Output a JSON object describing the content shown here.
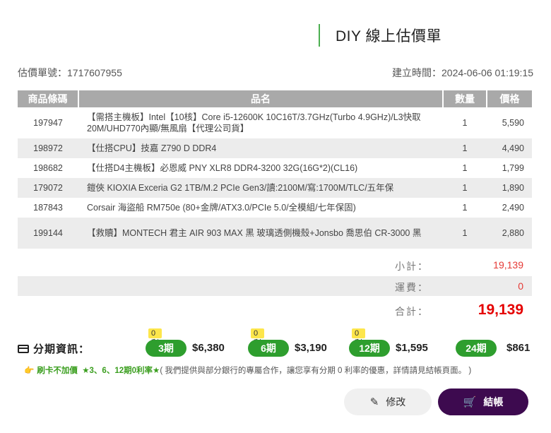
{
  "header": {
    "title": "DIY 線上估價單"
  },
  "meta": {
    "quote_no": "估價單號：1717607955",
    "created": "建立時間：2024-06-06 01:19:15"
  },
  "table": {
    "headers": [
      "商品條碼",
      "品名",
      "數量",
      "價格"
    ],
    "rows": [
      {
        "code": "197947",
        "name": "【需搭主機板】Intel【10核】Core i5-12600K 10C16T/3.7GHz(Turbo 4.9GHz)/L3快取20M/UHD770內顯/無風扇【代理公司貨】",
        "qty": "1",
        "price": "5,590"
      },
      {
        "code": "198972",
        "name": "【仕搭CPU】技嘉 Z790 D DDR4",
        "qty": "1",
        "price": "4,490"
      },
      {
        "code": "198682",
        "name": "【仕搭D4主機板】必恩威 PNY XLR8 DDR4-3200 32G(16G*2)(CL16)",
        "qty": "1",
        "price": "1,799"
      },
      {
        "code": "179072",
        "name": "鎧俠 KIOXIA Exceria G2 1TB/M.2 PCIe Gen3/讀:2100M/寫:1700M/TLC/五年保",
        "qty": "1",
        "price": "1,890"
      },
      {
        "code": "187843",
        "name": "Corsair 海盜船 RM750e (80+金牌/ATX3.0/PCIe 5.0/全模組/七年保固)",
        "qty": "1",
        "price": "2,490"
      },
      {
        "code": "199144",
        "name": "【救贖】MONTECH 君主 AIR 903 MAX 黑 玻璃透側機殼+Jonsbo 喬思伯 CR-3000 黑",
        "qty": "1",
        "price": "2,880"
      }
    ]
  },
  "summary": {
    "subtotal_label": "小計：",
    "subtotal": "19,139",
    "shipping_label": "運費：",
    "shipping": "0",
    "total_label": "合計：",
    "total": "19,139"
  },
  "installment": {
    "title": "分期資訊：",
    "plans": [
      {
        "badge": "0利率",
        "term": "3期",
        "amount": "$6,380"
      },
      {
        "badge": "0利率",
        "term": "6期",
        "amount": "$3,190"
      },
      {
        "badge": "0利率",
        "term": "12期",
        "amount": "$1,595"
      },
      {
        "badge": "",
        "term": "24期",
        "amount": "$861"
      }
    ],
    "notice_bold1": "刷卡不加價",
    "notice_bold2": "★3、6、12期0利率★",
    "notice_text": "( 我們提供與部分銀行的專屬合作，讓您享有分期 0 利率的優惠，詳情請見結帳頁面。 )"
  },
  "actions": {
    "edit_label": "修改",
    "checkout_label": "結帳"
  },
  "icons": {
    "card": "credit-card-icon",
    "hand": "pointing-hand-icon",
    "pencil": "pencil-icon",
    "cart": "cart-icon"
  },
  "colors": {
    "accent_green": "#2e9e2e",
    "price_red": "#e50000",
    "checkout_purple": "#3d0a4f",
    "badge_yellow": "#fde64b"
  }
}
